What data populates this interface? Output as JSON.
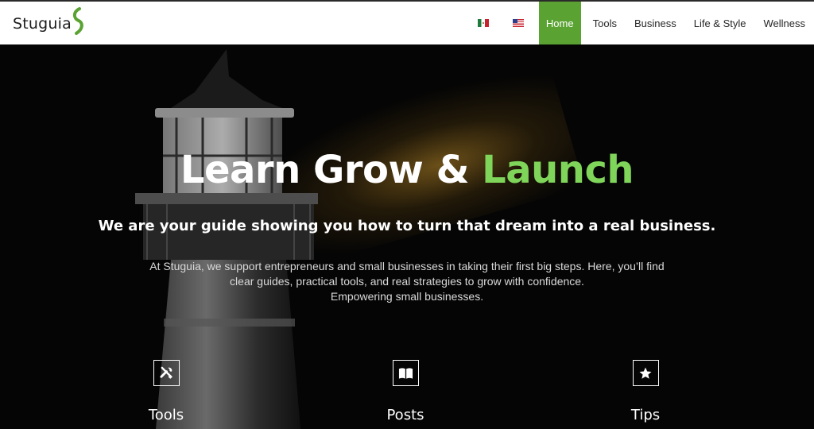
{
  "header": {
    "logo_text": "Stuguia",
    "brand_color": "#5aa333",
    "flags": [
      {
        "name": "mexico-flag-icon"
      },
      {
        "name": "us-flag-icon"
      }
    ],
    "nav": [
      {
        "label": "Home",
        "active": true
      },
      {
        "label": "Tools"
      },
      {
        "label": "Business"
      },
      {
        "label": "Life & Style"
      },
      {
        "label": "Wellness"
      }
    ]
  },
  "hero": {
    "title_part1": "Learn Grow & ",
    "title_accent": "Launch",
    "accent_color": "#7fd45a",
    "subtitle": "We are your guide showing you how to turn that dream into a real business.",
    "description": [
      "At Stuguia, we support entrepreneurs and small businesses in taking their first big steps. Here, you’ll find",
      "clear guides, practical tools, and real strategies to grow with confidence.",
      "Empowering small businesses."
    ]
  },
  "features": [
    {
      "label": "Tools",
      "icon": "tools-icon"
    },
    {
      "label": "Posts",
      "icon": "book-icon"
    },
    {
      "label": "Tips",
      "icon": "star-icon"
    }
  ]
}
